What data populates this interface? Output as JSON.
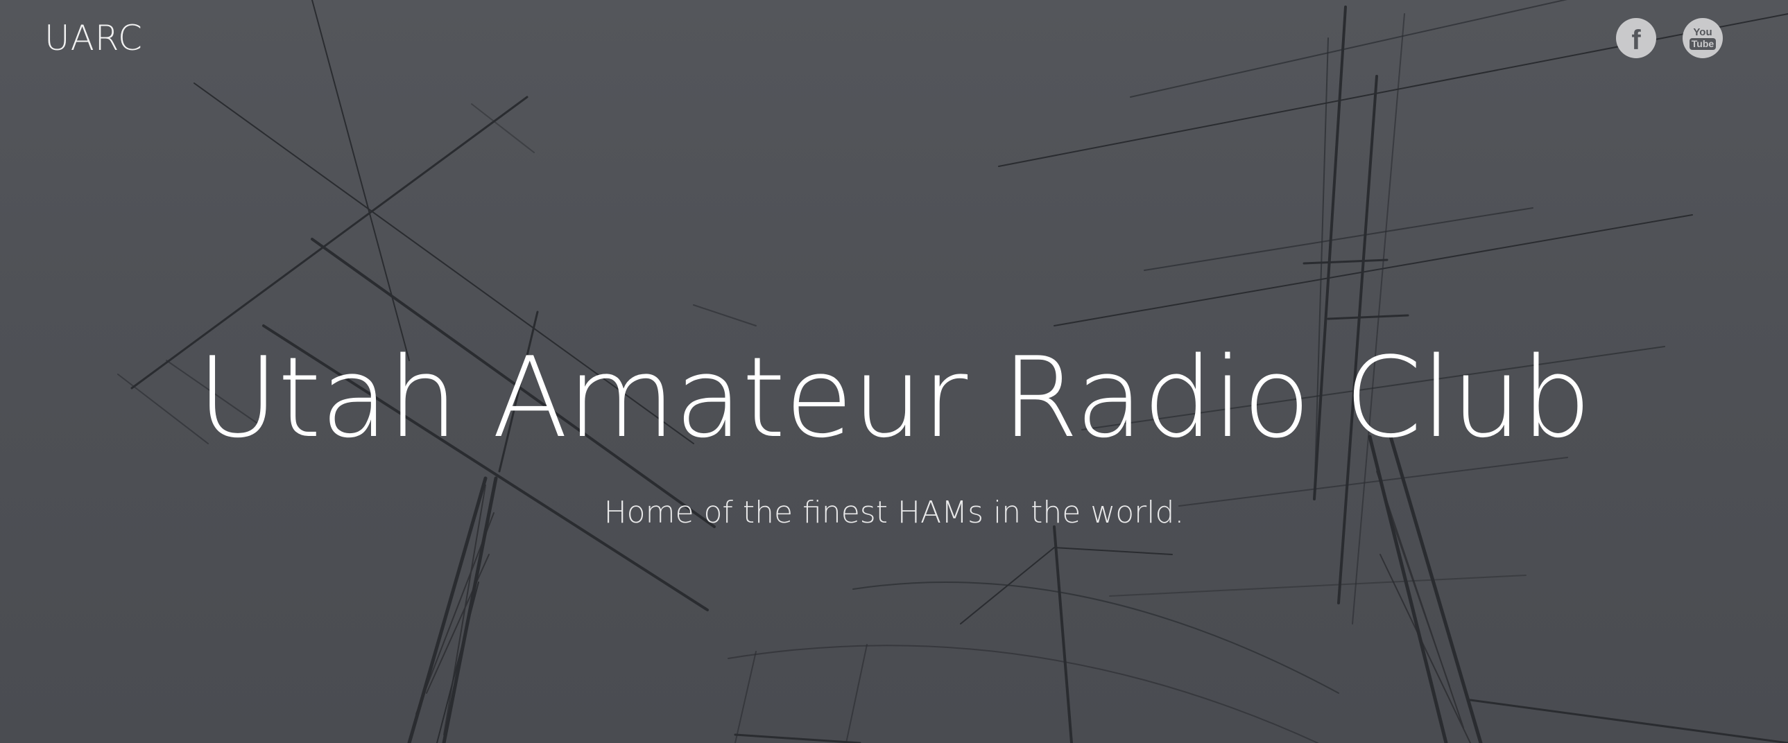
{
  "header": {
    "brand": "UARC"
  },
  "social": {
    "facebook": {
      "icon": "facebook-icon",
      "glyph": "f"
    },
    "youtube": {
      "icon": "youtube-icon",
      "glyph_top": "You",
      "glyph_bottom": "Tube"
    }
  },
  "hero": {
    "title": "Utah Amateur Radio Club",
    "subtitle": "Home of the finest HAMs in the world.",
    "background": "antenna-towers-photo"
  },
  "colors": {
    "background": "#505257",
    "text": "#ffffff",
    "icon_fill": "#c9c9cb"
  }
}
